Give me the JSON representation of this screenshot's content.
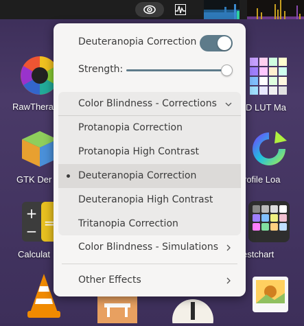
{
  "desktop": {
    "apps": [
      {
        "label": "RawThera",
        "icon": "rawtherapee-icon"
      },
      {
        "label": "GTK Der",
        "icon": "gtk-demo-icon"
      },
      {
        "label": "Calculat",
        "icon": "calculator-icon"
      },
      {
        "label": "D LUT Ma",
        "icon": "3d-lut-maker-icon"
      },
      {
        "label": "rofile Loa",
        "icon": "profile-loader-icon"
      },
      {
        "label": "estchart",
        "icon": "testchart-icon"
      }
    ]
  },
  "popover": {
    "toggle": {
      "label": "Deuteranopia Correction",
      "on": true
    },
    "strength": {
      "label": "Strength:",
      "value": 1.0
    },
    "corrections": {
      "header": "Color Blindness - Corrections",
      "items": [
        {
          "label": "Protanopia Correction",
          "selected": false
        },
        {
          "label": "Protanopia High Contrast",
          "selected": false
        },
        {
          "label": "Deuteranopia Correction",
          "selected": true
        },
        {
          "label": "Deuteranopia High Contrast",
          "selected": false
        },
        {
          "label": "Tritanopia Correction",
          "selected": false
        }
      ]
    },
    "simulations": {
      "label": "Color Blindness - Simulations"
    },
    "other": {
      "label": "Other Effects"
    }
  },
  "colors": {
    "accent": "#5e7b8a",
    "popover_bg": "#f6f5f4",
    "topbar": "#1e1e1e"
  }
}
